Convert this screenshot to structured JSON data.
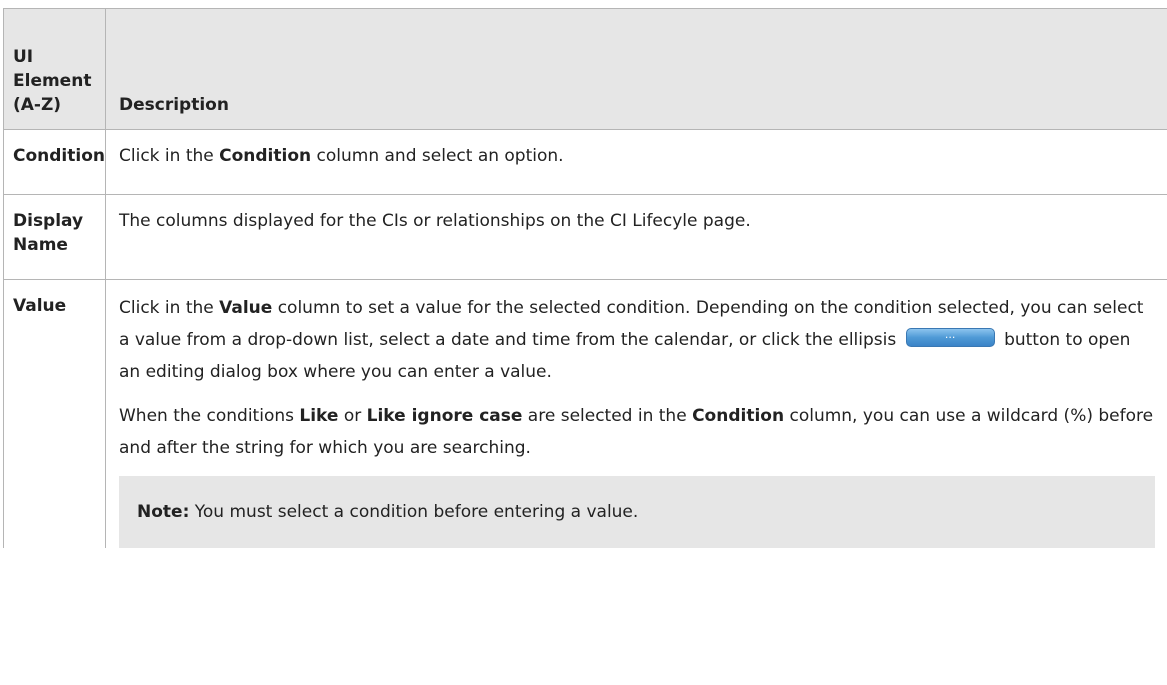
{
  "table": {
    "headers": {
      "element": "UI Element (A-Z)",
      "description": "Description"
    },
    "rows": [
      {
        "name": "Condition",
        "desc": {
          "p1_a": "Click in the ",
          "p1_b": "Condition",
          "p1_c": " column and select an option."
        }
      },
      {
        "name": "Display Name",
        "desc": {
          "p1": "The columns displayed for the CIs or relationships on the CI Lifecyle page."
        }
      },
      {
        "name": "Value",
        "desc": {
          "p1_a": "Click in the ",
          "p1_b": "Value",
          "p1_c": " column to set a value for the selected condition. Depending on the condition selected, you can select a value from a drop-down list, select a date and time from the calendar, or click the ellipsis",
          "button_label": "...",
          "p1_d": "button to open an editing dialog box where you can enter a value.",
          "p2_a": "When the conditions ",
          "p2_b": "Like",
          "p2_c": " or ",
          "p2_d": "Like ignore case",
          "p2_e": " are selected in the ",
          "p2_f": "Condition",
          "p2_g": " column, you can use a wildcard (%) before and after the string for which you are searching.",
          "note_label": "Note:",
          "note_text": " You must select a condition before entering a value."
        }
      }
    ]
  }
}
